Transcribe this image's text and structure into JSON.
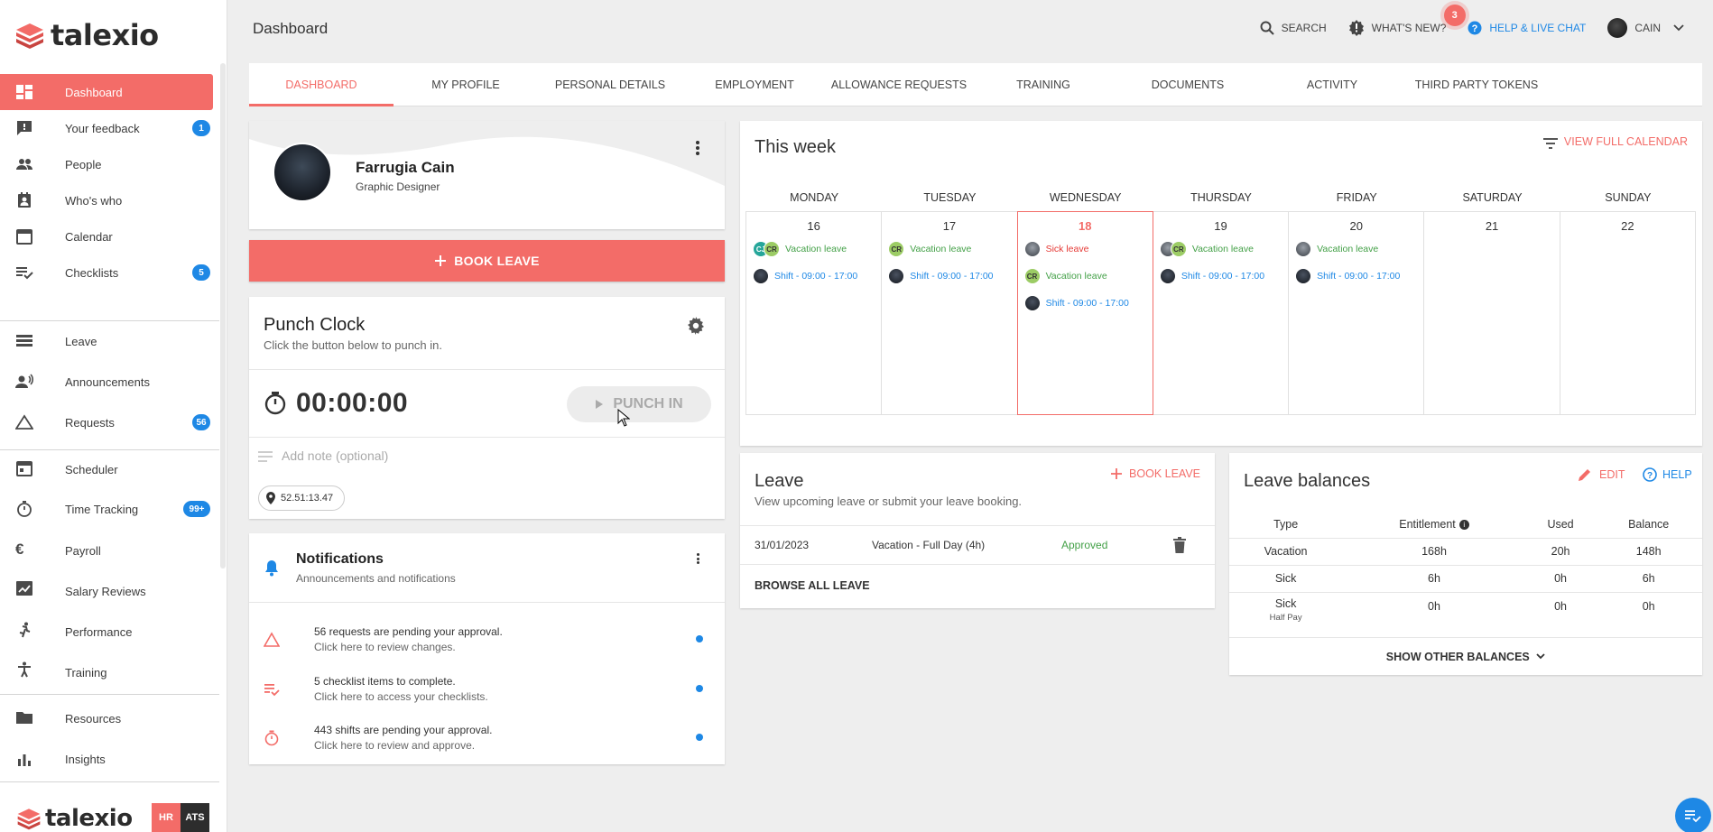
{
  "brand": {
    "name": "talexio",
    "accent": "#f36c68",
    "link": "#1e88e5"
  },
  "header": {
    "title": "Dashboard",
    "search": "SEARCH",
    "whats_new": "WHAT'S NEW?",
    "whats_new_badge": "3",
    "help": "HELP & LIVE CHAT",
    "user": "CAIN"
  },
  "sidebar": {
    "items": [
      {
        "label": "Dashboard",
        "icon": "dashboard-icon"
      },
      {
        "label": "Your feedback",
        "badge": "1",
        "icon": "feedback-icon"
      },
      {
        "label": "People",
        "icon": "people-icon"
      },
      {
        "label": "Who's who",
        "icon": "contact-icon"
      },
      {
        "label": "Calendar",
        "icon": "calendar-icon"
      },
      {
        "label": "Checklists",
        "badge": "5",
        "icon": "checklist-icon"
      },
      {
        "label": "Leave",
        "icon": "leave-icon"
      },
      {
        "label": "Announcements",
        "icon": "announcement-icon"
      },
      {
        "label": "Requests",
        "badge": "56",
        "icon": "warning-triangle-icon"
      },
      {
        "label": "Scheduler",
        "icon": "scheduler-icon"
      },
      {
        "label": "Time Tracking",
        "badge": "99+",
        "icon": "stopwatch-icon"
      },
      {
        "label": "Payroll",
        "icon": "euro-icon"
      },
      {
        "label": "Salary Reviews",
        "icon": "salary-icon"
      },
      {
        "label": "Performance",
        "icon": "running-icon"
      },
      {
        "label": "Training",
        "icon": "accessibility-icon"
      },
      {
        "label": "Resources",
        "icon": "folder-icon"
      },
      {
        "label": "Insights",
        "icon": "bar-chart-icon"
      }
    ],
    "footer_brand": "talexio",
    "hr": "HR",
    "ats": "ATS"
  },
  "tabs": [
    "DASHBOARD",
    "MY PROFILE",
    "PERSONAL DETAILS",
    "EMPLOYMENT",
    "ALLOWANCE REQUESTS",
    "TRAINING",
    "DOCUMENTS",
    "ACTIVITY",
    "THIRD PARTY TOKENS"
  ],
  "profile": {
    "name": "Farrugia Cain",
    "role": "Graphic Designer"
  },
  "book_leave": "BOOK LEAVE",
  "punch_clock": {
    "title": "Punch Clock",
    "subtitle": "Click the button below to punch in.",
    "timer": "00:00:00",
    "button": "PUNCH IN",
    "note_placeholder": "Add note (optional)",
    "location": "52.51:13.47"
  },
  "notifications": {
    "title": "Notifications",
    "subtitle": "Announcements and notifications",
    "items": [
      {
        "line1": "56 requests are pending your approval.",
        "line2": "Click here to review changes."
      },
      {
        "line1": "5 checklist items to complete.",
        "line2": "Click here to access your checklists."
      },
      {
        "line1": "443 shifts are pending your approval.",
        "line2": "Click here to review and approve."
      }
    ]
  },
  "week": {
    "title": "This week",
    "view_full": "VIEW FULL CALENDAR",
    "days": [
      {
        "name": "MONDAY",
        "num": "16"
      },
      {
        "name": "TUESDAY",
        "num": "17"
      },
      {
        "name": "WEDNESDAY",
        "num": "18"
      },
      {
        "name": "THURSDAY",
        "num": "19"
      },
      {
        "name": "FRIDAY",
        "num": "20"
      },
      {
        "name": "SATURDAY",
        "num": "21"
      },
      {
        "name": "SUNDAY",
        "num": "22"
      }
    ],
    "vacation": "Vacation leave",
    "sick": "Sick leave",
    "shift": "Shift - 09:00 - 17:00",
    "initials_cj": "CJ",
    "initials_cr": "CR"
  },
  "leave": {
    "title": "Leave",
    "subtitle": "View upcoming leave or submit your leave booking.",
    "book": "BOOK LEAVE",
    "row": {
      "date": "31/01/2023",
      "type": "Vacation - Full Day (4h)",
      "status": "Approved"
    },
    "browse": "BROWSE ALL LEAVE"
  },
  "balances": {
    "title": "Leave balances",
    "edit": "EDIT",
    "help": "HELP",
    "headers": [
      "Type",
      "Entitlement",
      "Used",
      "Balance"
    ],
    "info": "i",
    "rows": [
      {
        "type": "Vacation",
        "sub": "",
        "entitlement": "168h",
        "used": "20h",
        "balance": "148h"
      },
      {
        "type": "Sick",
        "sub": "",
        "entitlement": "6h",
        "used": "0h",
        "balance": "6h"
      },
      {
        "type": "Sick",
        "sub": "Half Pay",
        "entitlement": "0h",
        "used": "0h",
        "balance": "0h"
      }
    ],
    "show_other": "SHOW OTHER BALANCES"
  }
}
